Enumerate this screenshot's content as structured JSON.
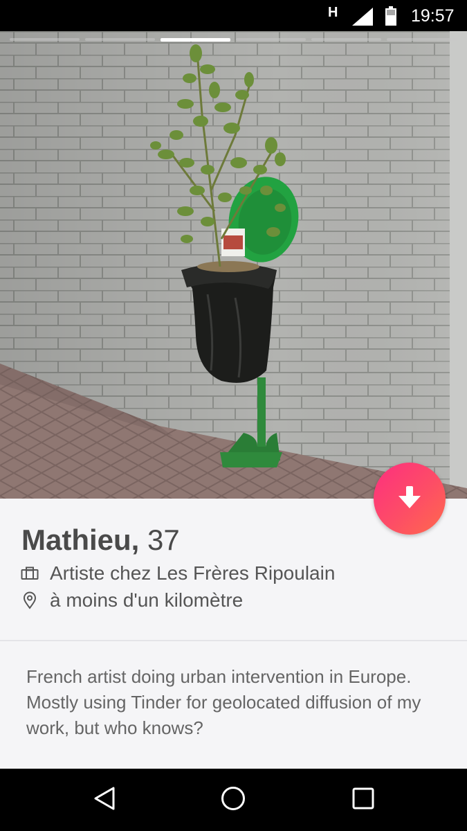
{
  "status_bar": {
    "network_type": "H",
    "time": "19:57",
    "icons": [
      "signal-icon",
      "battery-icon"
    ]
  },
  "photo": {
    "pager_count": 6,
    "active_index": 2
  },
  "profile": {
    "name": "Mathieu,",
    "age": "37",
    "job": "Artiste chez Les Frères Ripoulain",
    "distance": "à moins d'un kilomètre",
    "bio": "French artist doing urban intervention in Europe. Mostly using Tinder for geolocated diffusion of my work, but who knows?",
    "job_icon": "briefcase-icon",
    "distance_icon": "location-pin-icon"
  },
  "actions": {
    "collapse_icon": "arrow-down-icon",
    "accent_gradient": [
      "#fd2f7f",
      "#ff6a4c"
    ]
  },
  "nav_bar": {
    "icons": [
      "back-icon",
      "home-icon",
      "recents-icon"
    ]
  }
}
